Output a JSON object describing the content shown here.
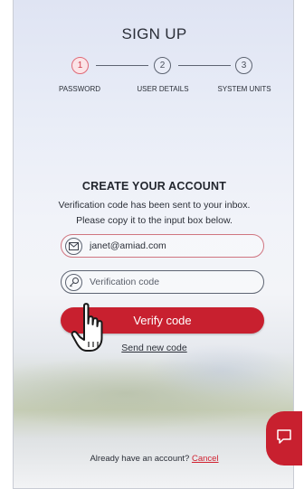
{
  "title": "SIGN UP",
  "steps": [
    {
      "number": "1",
      "label": "PASSWORD",
      "active": true
    },
    {
      "number": "2",
      "label": "USER DETAILS",
      "active": false
    },
    {
      "number": "3",
      "label": "SYSTEM UNITS",
      "active": false
    }
  ],
  "form": {
    "heading": "CREATE YOUR ACCOUNT",
    "info_line1": "Verification code has been sent to your inbox.",
    "info_line2": "Please copy it to the input box below.",
    "email_value": "janet@amiad.com",
    "code_placeholder": "Verification code",
    "verify_label": "Verify code",
    "send_new_label": "Send new code"
  },
  "footer": {
    "question": "Already have an account?",
    "cancel_label": "Cancel"
  },
  "icons": {
    "email": "envelope-icon",
    "code": "key-icon",
    "chat": "chat-bubble-icon",
    "cursor": "hand-pointer-icon"
  },
  "colors": {
    "accent": "#c8202f",
    "active_step": "#e06a78",
    "text": "#2b2f38"
  }
}
